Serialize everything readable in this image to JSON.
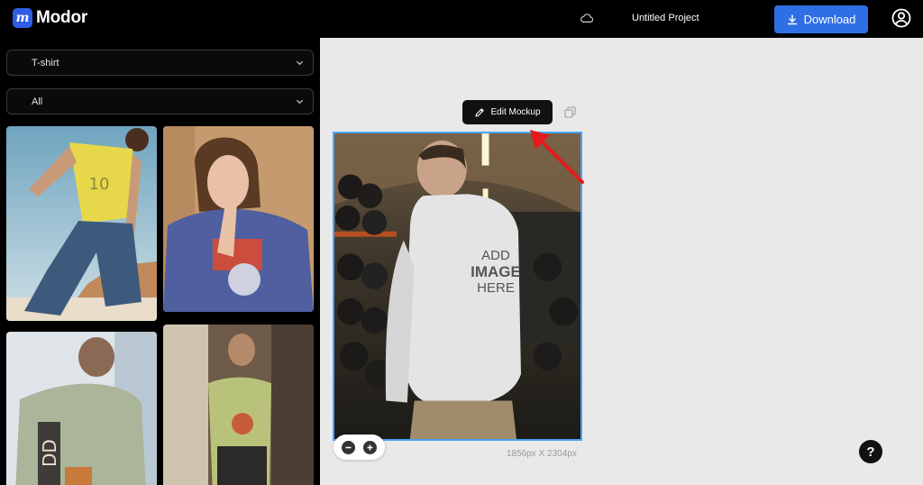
{
  "app": {
    "logo_letter": "m",
    "name": "Modor"
  },
  "header": {
    "project_title": "Untitled Project",
    "download_label": "Download",
    "icons": [
      "cloud-icon",
      "download-icon",
      "account-icon"
    ]
  },
  "sidebar": {
    "category_select": {
      "value": "T-shirt"
    },
    "filter_select": {
      "value": "All"
    },
    "thumbnails": [
      {
        "shirt_color": "#e6d84a",
        "print": "10"
      },
      {
        "shirt_color": "#4f5fa0",
        "print": ""
      },
      {
        "shirt_color": "#aab59a",
        "print": "DD"
      },
      {
        "shirt_color": "#b9c27a",
        "print": ""
      }
    ]
  },
  "canvas": {
    "edit_mockup_label": "Edit Mockup",
    "mockup_text": {
      "line1": "ADD",
      "line2": "IMAGE",
      "line3": "HERE"
    },
    "dimensions": "1856px X 2304px",
    "help_label": "?"
  },
  "colors": {
    "accent": "#2f6fe6",
    "selection": "#4aa3ff",
    "arrow": "#e41b1b",
    "topbar": "#000000",
    "canvas_bg": "#e9e9e9"
  }
}
